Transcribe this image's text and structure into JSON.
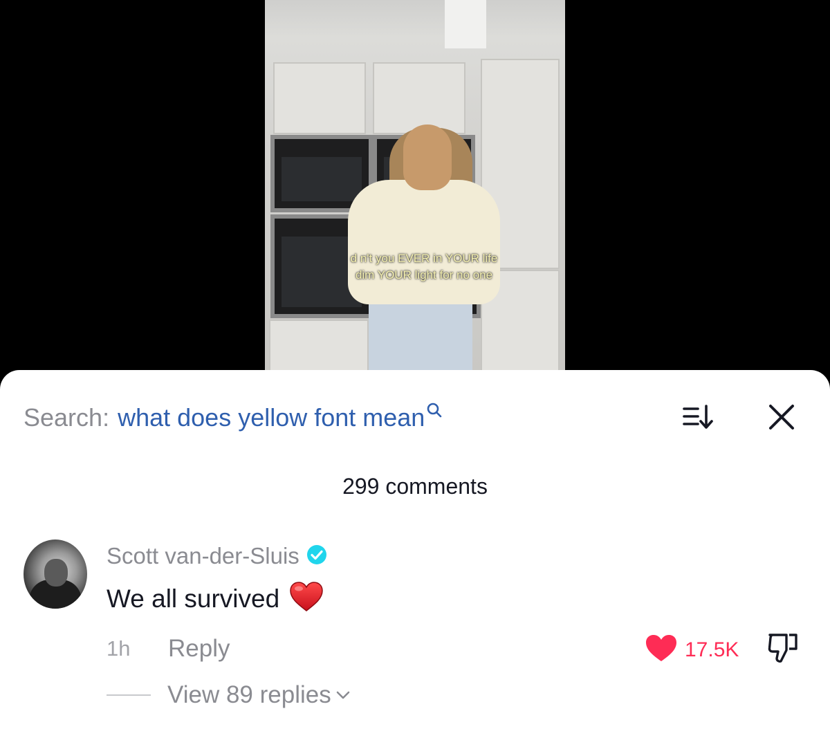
{
  "video": {
    "caption_line1": "d n't you EVER in YOUR life",
    "caption_line2": "dim YOUR light for no one"
  },
  "search": {
    "prefix": "Search:",
    "query": "what does yellow font mean"
  },
  "comments": {
    "count_label": "299 comments"
  },
  "comment": {
    "username": "Scott van-der-Sluis",
    "verified": true,
    "text": "We all survived",
    "emoji": "heart-emoji",
    "time": "1h",
    "reply_label": "Reply",
    "likes": "17.5K",
    "view_replies_label": "View 89 replies"
  },
  "colors": {
    "like": "#fe2c55",
    "verified": "#20d5ec",
    "query_link": "#2f5fae",
    "caption": "#f5f0b0"
  },
  "icons": [
    "search-icon",
    "sort-icon",
    "close-icon",
    "verified-icon",
    "heart-icon",
    "dislike-icon",
    "chevron-down-icon"
  ]
}
